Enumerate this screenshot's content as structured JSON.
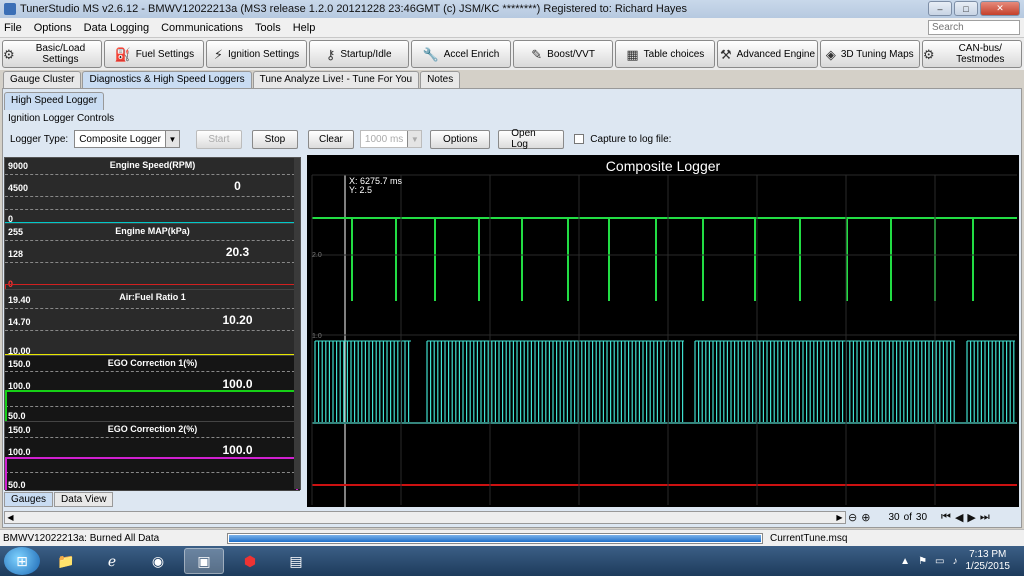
{
  "window": {
    "title": "TunerStudio MS v2.6.12 - BMWV12022213a (MS3 release 1.2.0     20121228 23:46GMT (c) JSM/KC ********) Registered to: Richard Hayes",
    "minimize": "–",
    "maximize": "□",
    "close": "✕"
  },
  "menu": {
    "items": [
      "File",
      "Options",
      "Data Logging",
      "Communications",
      "Tools",
      "Help"
    ],
    "search_placeholder": "Search"
  },
  "toolbar": {
    "buttons": [
      {
        "label": "Basic/Load Settings",
        "icon": "engine-icon"
      },
      {
        "label": "Fuel Settings",
        "icon": "fuel-injector-icon"
      },
      {
        "label": "Ignition Settings",
        "icon": "spark-plug-icon"
      },
      {
        "label": "Startup/Idle",
        "icon": "key-icon"
      },
      {
        "label": "Accel Enrich",
        "icon": "wrench-icon"
      },
      {
        "label": "Boost/VVT",
        "icon": "turbo-icon"
      },
      {
        "label": "Table choices",
        "icon": "table-icon"
      },
      {
        "label": "Advanced Engine",
        "icon": "hammer-icon"
      },
      {
        "label": "3D Tuning Maps",
        "icon": "map-icon"
      },
      {
        "label": "CAN-bus/ Testmodes",
        "icon": "can-bus-icon"
      }
    ]
  },
  "tabs": [
    "Gauge Cluster",
    "Diagnostics & High Speed Loggers",
    "Tune Analyze Live! - Tune For You",
    "Notes"
  ],
  "subtab": "High Speed Logger",
  "controls": {
    "title": "Ignition Logger Controls",
    "logger_type_label": "Logger Type:",
    "logger_type_value": "Composite Logger",
    "start": "Start",
    "stop": "Stop",
    "clear": "Clear",
    "interval": "1000 ms",
    "options": "Options",
    "open_log": "Open Log",
    "capture_label": "Capture to log file:"
  },
  "gauges": [
    {
      "title": "Engine Speed(RPM)",
      "max": "9000",
      "mid": "4500",
      "min": "0",
      "value": "0",
      "accent": "#00c8c8"
    },
    {
      "title": "Engine MAP(kPa)",
      "max": "255",
      "mid": "128",
      "min": "0",
      "value": "20.3",
      "accent": "#d22020"
    },
    {
      "title": "Air:Fuel Ratio 1",
      "max": "19.40",
      "mid": "14.70",
      "min": "10.00",
      "value": "10.20",
      "accent": "#e6e600"
    },
    {
      "title": "EGO Correction 1(%)",
      "max": "150.0",
      "mid": "100.0",
      "min": "50.0",
      "value": "100.0",
      "accent": "#16d016"
    },
    {
      "title": "EGO Correction 2(%)",
      "max": "150.0",
      "mid": "100.0",
      "min": "50.0",
      "value": "100.0",
      "accent": "#d020d0"
    }
  ],
  "bottom_tabs": [
    "Gauges",
    "Data View"
  ],
  "chart": {
    "title": "Composite Logger",
    "cursor_x": "X: 6275.7 ms",
    "cursor_y": "Y: 2.5",
    "ytick_top": "2.0",
    "ytick_bottom": "1.0"
  },
  "navigation": {
    "page_current": "30",
    "of_label": "of",
    "page_total": "30"
  },
  "status": {
    "left": "BMWV12022213a: Burned All Data",
    "right": "CurrentTune.msq",
    "progress": 1.0
  },
  "taskbar": {
    "time": "7:13 PM",
    "date": "1/25/2015"
  },
  "colors": {
    "trace_green": "#22dd44",
    "trace_cyan": "#40e0d0",
    "trace_red": "#cc1111",
    "cursor": "#ffffff"
  }
}
